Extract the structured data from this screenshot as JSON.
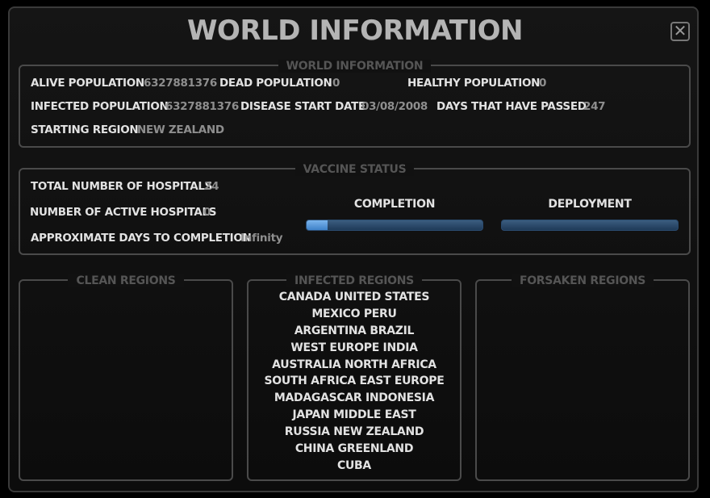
{
  "title": "WORLD INFORMATION",
  "close_icon": "close-icon",
  "world_info": {
    "legend": "WORLD INFORMATION",
    "alive_label": "ALIVE POPULATION",
    "alive_value": "6327881376",
    "dead_label": "DEAD POPULATION",
    "dead_value": "0",
    "healthy_label": "HEALTHY POPULATION",
    "healthy_value": "0",
    "infected_label": "INFECTED POPULATION",
    "infected_value": "6327881376",
    "start_date_label": "DISEASE START DATE",
    "start_date_value": "03/08/2008",
    "days_label": "DAYS THAT HAVE PASSED",
    "days_value": "247",
    "region_label": "STARTING REGION",
    "region_value": "NEW ZEALAND"
  },
  "vaccine": {
    "legend": "VACCINE STATUS",
    "hospitals_label": "TOTAL NUMBER OF HOSPITALS",
    "hospitals_value": "24",
    "active_label": "NUMBER OF ACTIVE HOSPITALS",
    "active_value": "0",
    "days_label": "APPROXIMATE DAYS TO COMPLETION",
    "days_value": "Infinity",
    "completion_label": "COMPLETION",
    "completion_progress": 0.12,
    "deployment_label": "DEPLOYMENT",
    "deployment_progress": 0.0,
    "bar_color": "#2f5a86",
    "fill_color": "#5f9fe0"
  },
  "clean": {
    "legend": "CLEAN REGIONS",
    "regions": []
  },
  "infected": {
    "legend": "INFECTED REGIONS",
    "rows": [
      "CANADA  UNITED STATES",
      "MEXICO  PERU",
      "ARGENTINA  BRAZIL",
      "WEST EUROPE  INDIA",
      "AUSTRALIA  NORTH AFRICA",
      "SOUTH AFRICA  EAST EUROPE",
      "MADAGASCAR  INDONESIA",
      "JAPAN  MIDDLE EAST",
      "RUSSIA  NEW ZEALAND",
      "CHINA  GREENLAND",
      "CUBA"
    ]
  },
  "forsaken": {
    "legend": "FORSAKEN REGIONS",
    "regions": []
  }
}
